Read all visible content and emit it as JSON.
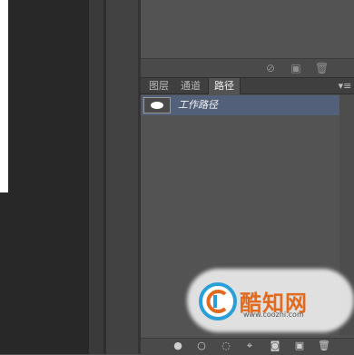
{
  "panels": {
    "upper_footer_icons": [
      "no-icon",
      "new-layer-icon",
      "trash-icon"
    ],
    "paths": {
      "tabs": [
        {
          "label": "图层",
          "active": false
        },
        {
          "label": "通道",
          "active": false
        },
        {
          "label": "路径",
          "active": true
        }
      ],
      "menu_glyph": "▾≡",
      "items": [
        {
          "label": "工作路径",
          "selected": true
        }
      ],
      "footer_icons": [
        "fill-path-icon",
        "stroke-path-icon",
        "load-selection-icon",
        "make-work-path-icon",
        "add-mask-icon",
        "new-path-icon",
        "delete-path-icon"
      ]
    }
  },
  "watermark": {
    "name": "酷知网",
    "url": "www.coozhi.com"
  },
  "colors": {
    "selection": "#52607a",
    "panel_bg": "#535353",
    "canvas_bg": "#282828",
    "watermark_orange": "#e06a20",
    "watermark_blue": "#2a9fd8"
  }
}
